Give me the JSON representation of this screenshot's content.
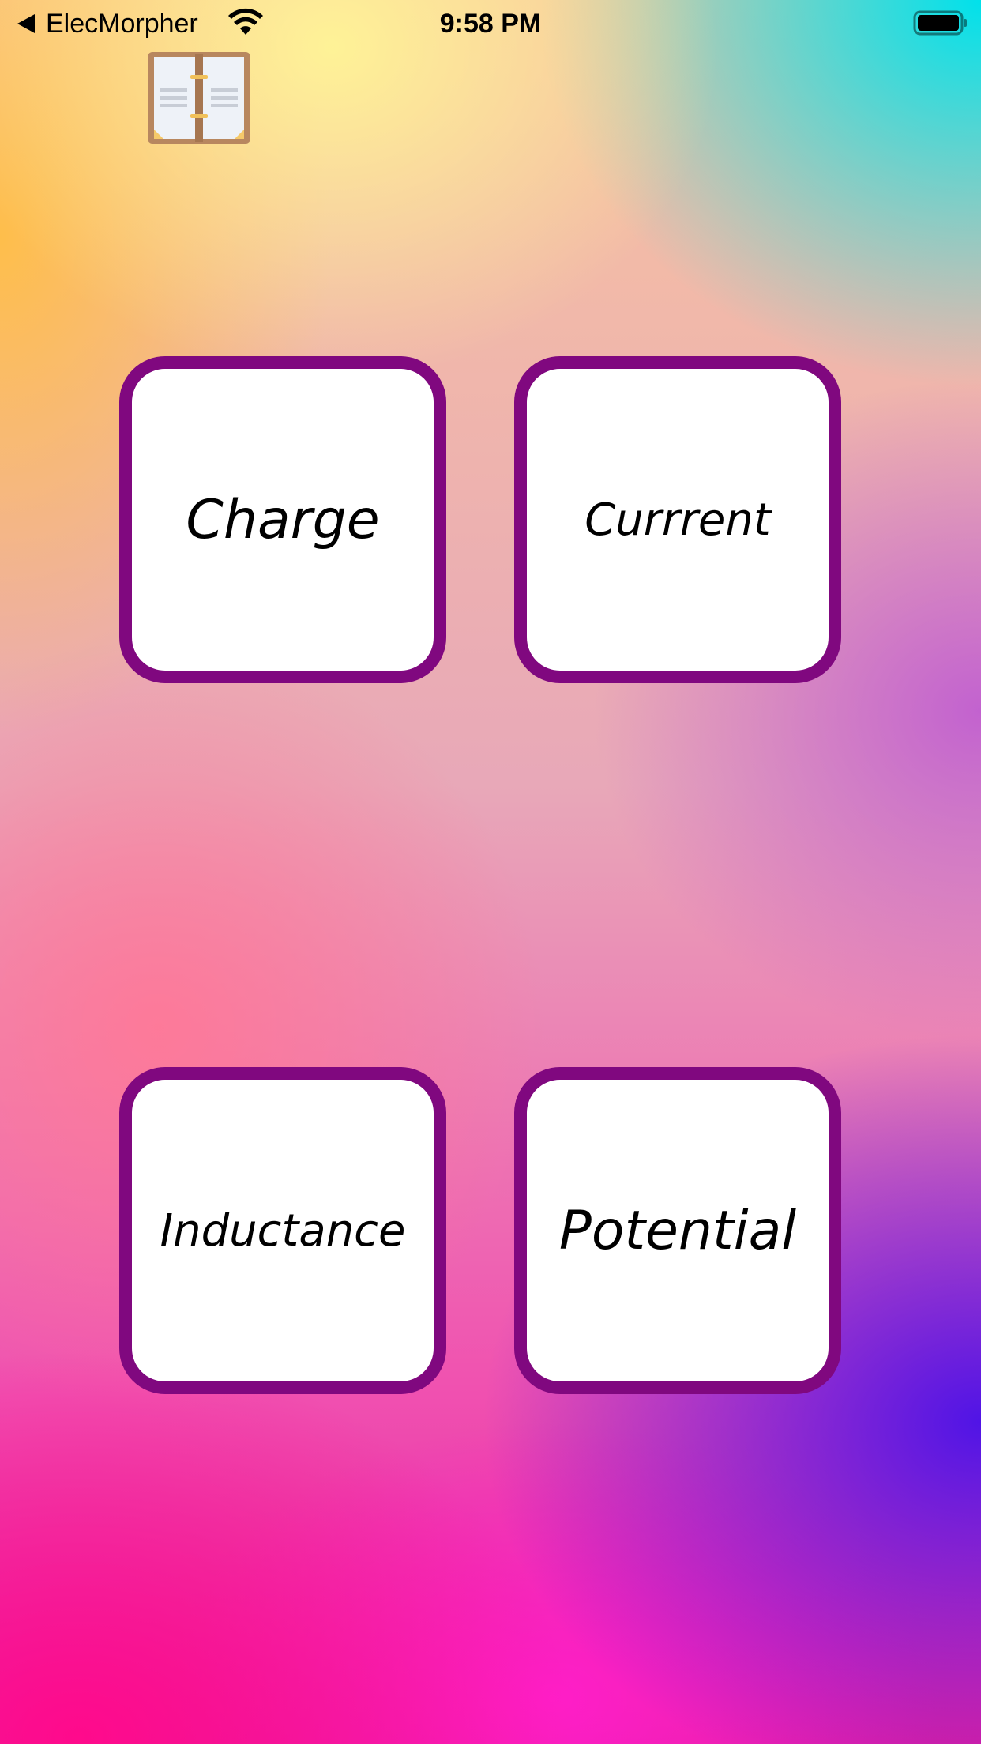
{
  "status_bar": {
    "back_app": "ElecMorpher",
    "time": "9:58 PM",
    "icons": [
      "back-arrow-icon",
      "wifi-icon",
      "battery-icon"
    ]
  },
  "header": {
    "icon": "book-icon"
  },
  "tiles": [
    {
      "label": "Charge"
    },
    {
      "label": "Currrent"
    },
    {
      "label": "Inductance"
    },
    {
      "label": "Potential"
    }
  ],
  "colors": {
    "tile_border": "#80087f",
    "tile_fill": "#ffffff",
    "text": "#000000"
  }
}
